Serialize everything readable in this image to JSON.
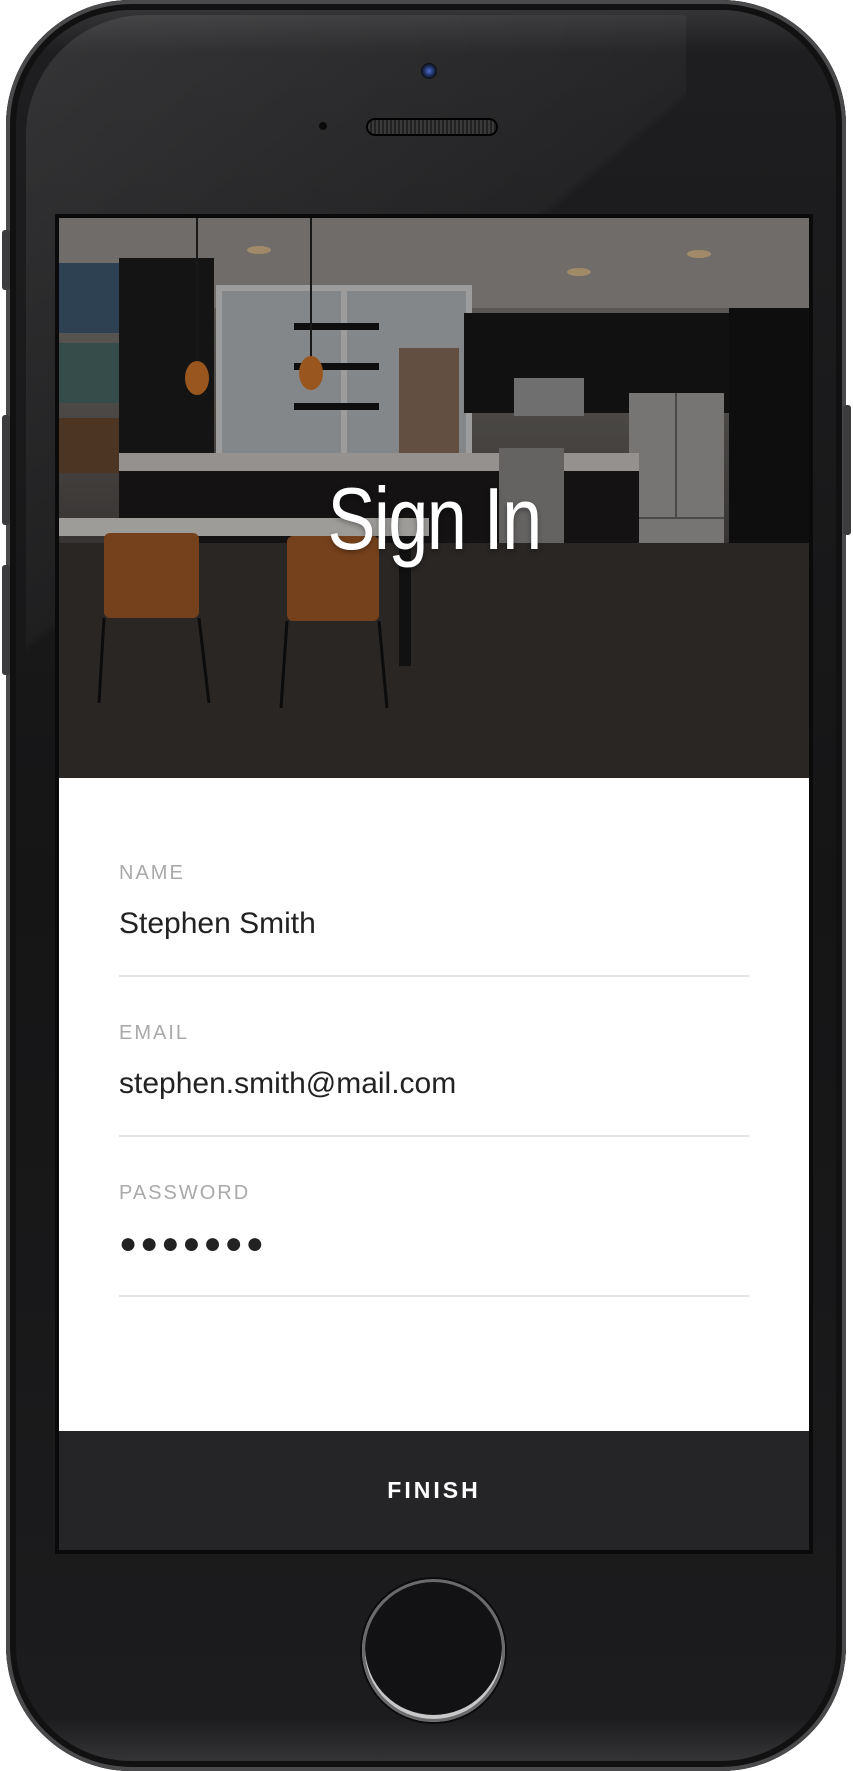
{
  "device": {
    "model_icon": "phone-frame"
  },
  "hero": {
    "title": "Sign In",
    "image_subject": "modern kitchen photograph"
  },
  "form": {
    "fields": [
      {
        "label": "NAME",
        "value": "Stephen Smith",
        "type": "text"
      },
      {
        "label": "EMAIL",
        "value": "stephen.smith@mail.com",
        "type": "email"
      },
      {
        "label": "PASSWORD",
        "value": "●●●●●●●",
        "type": "password"
      }
    ]
  },
  "actions": {
    "finish_label": "FINISH"
  },
  "colors": {
    "screen_bg": "#ffffff",
    "label": "#a9a9a9",
    "text": "#222222",
    "divider": "#e2e2e2",
    "button_bg": "#252527",
    "button_text": "#ffffff",
    "phone_body": "#151516"
  }
}
